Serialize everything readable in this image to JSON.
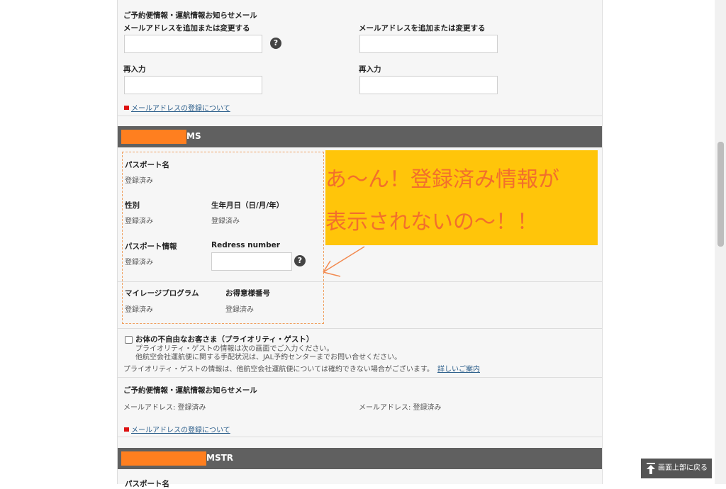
{
  "top_section": {
    "heading": "ご予約便情報・運航情報お知らせメール",
    "email_label_1": "メールアドレスを追加または変更する",
    "email_label_2": "メールアドレスを追加または変更する",
    "reenter_label_1": "再入力",
    "reenter_label_2": "再入力",
    "help_glyph": "?",
    "link_label": "メールアドレスの登録について"
  },
  "passenger1": {
    "name_suffix": "MS",
    "passport_name_label": "パスポート名",
    "passport_name_value": "登録済み",
    "gender_label": "性別",
    "gender_value": "登録済み",
    "birthdate_label": "生年月日（日/月/年）",
    "birthdate_value": "登録済み",
    "passport_info_label": "パスポート情報",
    "passport_info_value": "登録済み",
    "redress_label": "Redress number",
    "mileage_label": "マイレージプログラム",
    "mileage_value": "登録済み",
    "customer_no_label": "お得意様番号",
    "customer_no_value": "登録済み",
    "priority_label": "お体の不自由なお客さま（プライオリティ・ゲスト）",
    "priority_line1": "プライオリティ・ゲストの情報は次の画面でご入力ください。",
    "priority_line2": "他航空会社運航便に関する手配状況は、JAL予約センターまでお問い合せください。",
    "priority_note": "プライオリティ・ゲストの情報は、他航空会社運航便については確約できない場合がございます。",
    "priority_link": "詳しいご案内",
    "mail_heading": "ご予約便情報・運航情報お知らせメール",
    "mail_value_1": "メールアドレス: 登録済み",
    "mail_value_2": "メールアドレス: 登録済み",
    "mail_link": "メールアドレスの登録について"
  },
  "passenger2": {
    "name_suffix": "MSTR",
    "partial_label": "パスポート名"
  },
  "annotation": {
    "line1": "あ〜ん！登録済み情報が",
    "line2": "表示されないの〜！！"
  },
  "back_to_top": {
    "label": "画面上部に戻る"
  },
  "colors": {
    "header_bar": "#606060",
    "redaction": "#ff7f1f",
    "note_bg": "#ffc50a",
    "note_text": "#f26f2c",
    "link": "#2a5d8a"
  }
}
